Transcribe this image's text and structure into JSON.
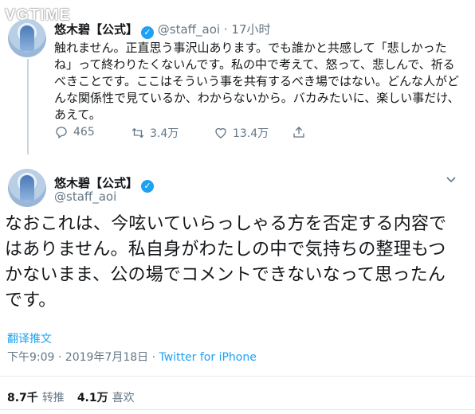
{
  "watermark": "VGTIME",
  "tweet1": {
    "name": "悠木碧【公式】",
    "handle": "@staff_aoi",
    "sep": "·",
    "time": "17小时",
    "text": "触れません。正直思う事沢山あります。でも誰かと共感して「悲しかった\nね」って終わりたくないんです。私の中で考えて、怒って、悲しんで、祈る\nべきことです。ここはそういう事を共有するべき場ではない。どんな人がど\nんな関係性で見ているか、わからないから。バカみたいに、楽しい事だけ、\nあえて。",
    "replies": "465",
    "retweets": "3.4万",
    "likes": "13.4万"
  },
  "tweet2": {
    "name": "悠木碧【公式】",
    "handle": "@staff_aoi",
    "text": "なおこれは、今呟いていらっしゃる方を否定する内容で\nはありません。私自身がわたしの中で気持ちの整理もつ\nかないまま、公の場でコメントできないなって思ったん\nです。",
    "translate": "翻译推文",
    "timestamp": "下午9:09 · 2019年7月18日 · ",
    "source": "Twitter for iPhone",
    "retweet_count": "8.7千",
    "retweet_label": "转推",
    "like_count": "4.1万",
    "like_label": "喜欢"
  },
  "colors": {
    "link": "#1da1f2",
    "muted": "#657786",
    "text": "#14171a"
  }
}
